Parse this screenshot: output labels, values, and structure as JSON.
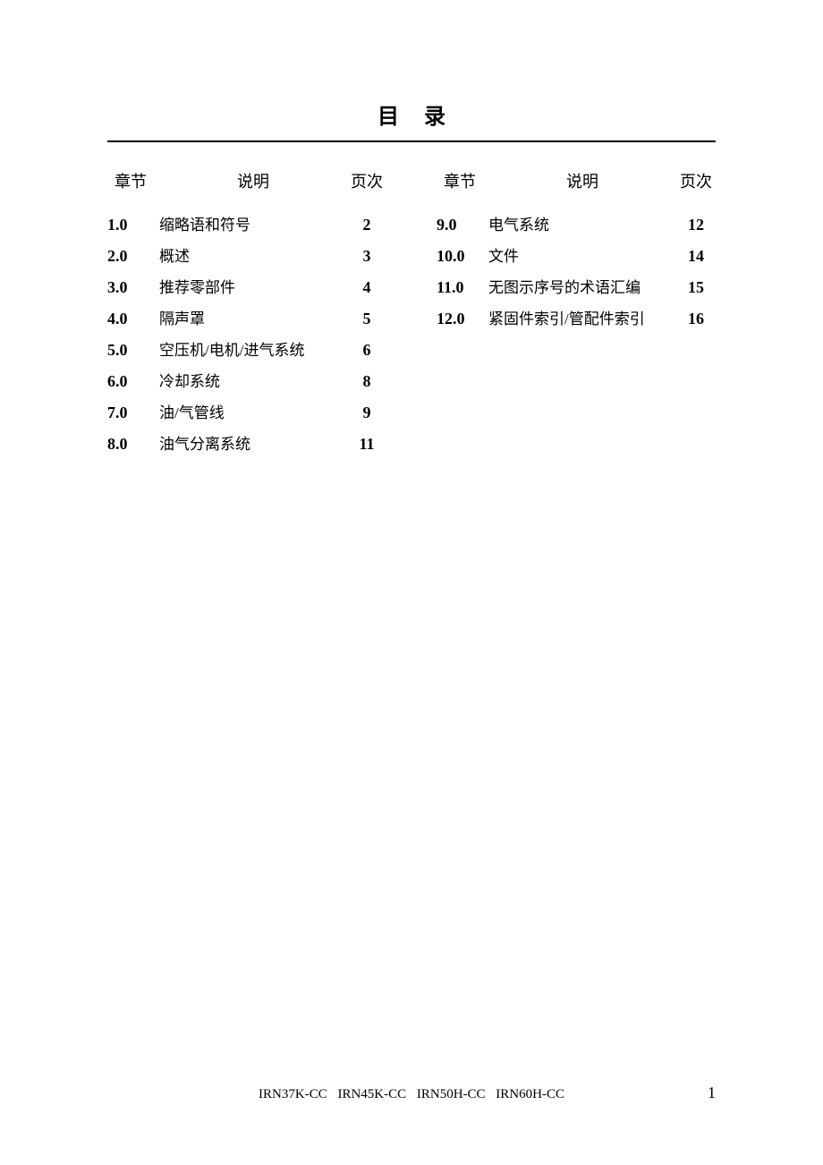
{
  "title": "目录",
  "headers": {
    "section": "章节",
    "description": "说明",
    "page": "页次"
  },
  "columns": [
    [
      {
        "section": "1.0",
        "description": "缩略语和符号",
        "page": "2"
      },
      {
        "section": "2.0",
        "description": "概述",
        "page": "3"
      },
      {
        "section": "3.0",
        "description": "推荐零部件",
        "page": "4"
      },
      {
        "section": "4.0",
        "description": "隔声罩",
        "page": "5"
      },
      {
        "section": "5.0",
        "description": "空压机/电机/进气系统",
        "page": "6"
      },
      {
        "section": "6.0",
        "description": "冷却系统",
        "page": "8"
      },
      {
        "section": "7.0",
        "description": "油/气管线",
        "page": "9"
      },
      {
        "section": "8.0",
        "description": "油气分离系统",
        "page": "11"
      }
    ],
    [
      {
        "section": "9.0",
        "description": "电气系统",
        "page": "12"
      },
      {
        "section": "10.0",
        "description": "文件",
        "page": "14"
      },
      {
        "section": "11.0",
        "description": "无图示序号的术语汇编",
        "page": "15"
      },
      {
        "section": "12.0",
        "description": "紧固件索引/管配件索引",
        "page": "16"
      }
    ]
  ],
  "footer": "IRN37K-CC IRN45K-CC IRN50H-CC IRN60H-CC",
  "page_number": "1"
}
